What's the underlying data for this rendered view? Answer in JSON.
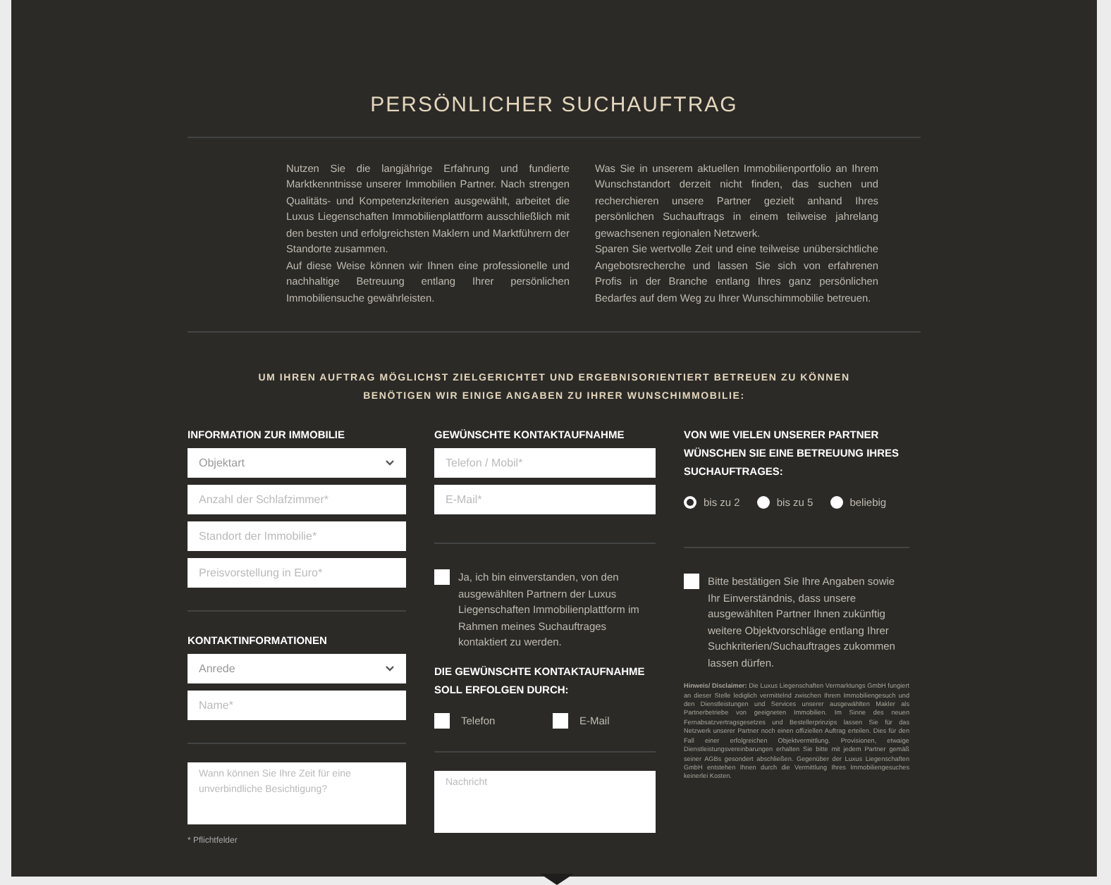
{
  "title": "PERSÖNLICHER SUCHAUFTRAG",
  "intro": [
    "Nutzen Sie die langjährige Erfahrung und fundierte Marktkenntnisse unserer Immobilien Partner. Nach strengen Qualitäts- und Kompetenzkriterien ausgewählt, arbeitet die Luxus Liegenschaften Immobilienplattform ausschließlich mit den besten und erfolgreichsten Maklern und Marktführern der Standorte zusammen.\nAuf diese Weise können wir Ihnen eine professionelle und nachhaltige Betreuung entlang Ihrer persönlichen Immobiliensuche gewährleisten.",
    "Was Sie in unserem aktuellen Immobilienportfolio an Ihrem Wunschstandort derzeit nicht finden, das suchen und recherchieren unsere Partner gezielt anhand Ihres persönlichen Suchauftrags in einem teilweise jahrelang gewachsenen regionalen Netzwerk.\nSparen Sie wertvolle Zeit und eine teilweise unübersichtliche Angebotsrecherche und lassen Sie sich von erfahrenen Profis in der Branche entlang Ihres ganz persönlichen Bedarfes auf dem Weg zu Ihrer Wunschimmobilie betreuen."
  ],
  "subtitle": "UM IHREN AUFTRAG MÖGLICHST ZIELGERICHTET UND ERGEBNISORIENTIERT BETREUEN ZU KÖNNEN BENÖTIGEN WIR EINIGE ANGABEN ZU IHRER WUNSCHIMMOBILIE:",
  "property": {
    "heading": "INFORMATION ZUR IMMOBILIE",
    "fields": [
      {
        "kind": "select",
        "value": "Objektart"
      },
      {
        "kind": "input",
        "placeholder": "Anzahl der Schlafzimmer*"
      },
      {
        "kind": "input",
        "placeholder": "Standort der Immobilie*"
      },
      {
        "kind": "input",
        "placeholder": "Preisvorstellung in Euro*"
      }
    ]
  },
  "contact_info": {
    "heading": "KONTAKTINFORMATIONEN",
    "fields": [
      {
        "kind": "select",
        "value": "Anrede"
      },
      {
        "kind": "input",
        "placeholder": "Name*"
      }
    ]
  },
  "visit_field": {
    "placeholder": "Wann können Sie Ihre Zeit für eine unverbindliche Besichtigung?"
  },
  "required_note": "* Pflichtfelder",
  "contact": {
    "heading": "GEWÜNSCHTE KONTAKTAUFNAHME",
    "fields": [
      {
        "placeholder": "Telefon / Mobil*"
      },
      {
        "placeholder": "E-Mail*"
      }
    ],
    "consent": {
      "checked": false,
      "label": "Ja, ich bin einverstanden, von den ausgewählten Partnern der Luxus Liegenschaften Immobilienplattform im Rahmen meines Suchauftrages kontaktiert zu werden."
    },
    "method_heading": "DIE GEWÜNSCHTE KONTAKTAUFNAHME SOLL ERFOLGEN DURCH:",
    "methods": [
      {
        "label": "Telefon",
        "checked": false
      },
      {
        "label": "E-Mail",
        "checked": false
      }
    ],
    "message": {
      "placeholder": "Nachricht"
    }
  },
  "partners": {
    "heading": "VON WIE VIELEN UNSERER PARTNER WÜNSCHEN SIE EINE BETREUUNG IHRES SUCHAUFTRAGES:",
    "options": [
      {
        "label": "bis zu 2",
        "selected": true
      },
      {
        "label": "bis zu 5",
        "selected": false
      },
      {
        "label": "beliebig",
        "selected": false
      }
    ],
    "confirm": {
      "checked": false,
      "label": "Bitte bestätigen Sie Ihre Angaben sowie Ihr Einverständnis, dass unsere ausgewählten Partner Ihnen zukünftig weitere Objektvorschläge entlang Ihrer Suchkriterien/Suchauftrages zukommen lassen dürfen."
    },
    "disclaimer": "**Hinweis/ Disclaimer:** Die Luxus Liegenschaften Vermarktungs GmbH fungiert an dieser Stelle lediglich vermittelnd zwischen Ihrem Immobiliengesuch und den Dienstleistungen und Services unserer ausgewählten Makler als Partnerbetriebe von geeigneten Immobilien. Im Sinne des neuen Fernabsatzvertragsgesetzes und Bestellerprinzips lassen Sie für das Netzwerk unserer Partner noch einen offiziellen Auftrag erteilen. Dies für den Fall einer erfolgreichen Objektvermittlung. Provisionen, etwaige Dienstleistungsvereinbarungen erhalten Sie bitte mit jedem Partner gemäß seiner AGBs gesondert abschließen. Gegenüber der Luxus Liegenschaften GmbH entstehen Ihnen durch die Vermittlung Ihres Immobiliengesuches keinerlei Kosten."
  }
}
